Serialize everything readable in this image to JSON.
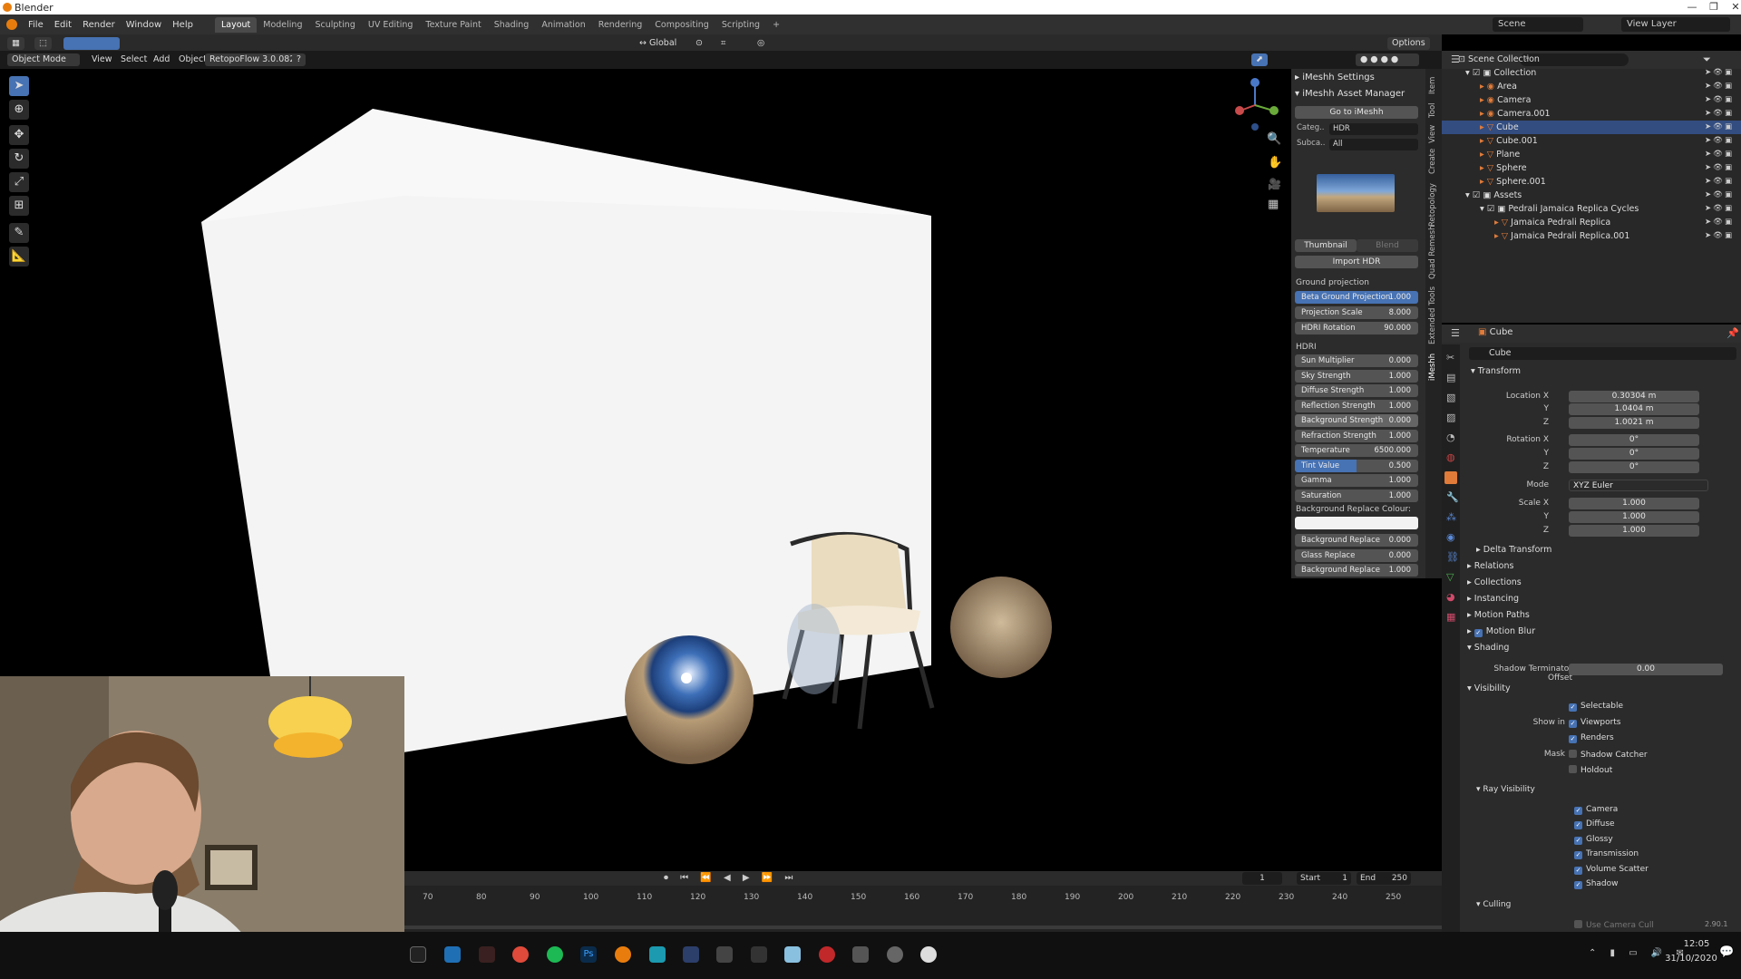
{
  "window": {
    "title": "Blender",
    "min": "—",
    "max": "❐",
    "close": "✕"
  },
  "menu": {
    "items": [
      "File",
      "Edit",
      "Render",
      "Window",
      "Help"
    ],
    "workspaces": [
      "Layout",
      "Modeling",
      "Sculpting",
      "UV Editing",
      "Texture Paint",
      "Shading",
      "Animation",
      "Rendering",
      "Compositing",
      "Scripting"
    ],
    "active_workspace": "Layout",
    "add_tab": "+",
    "scene": "Scene",
    "view_layer": "View Layer"
  },
  "viewport_header": {
    "orientation": "Global",
    "options": "Options"
  },
  "viewport_menu": {
    "mode": "Object Mode",
    "items": [
      "View",
      "Select",
      "Add",
      "Object"
    ],
    "addon": "RetopoFlow 3.0.082",
    "help": "?"
  },
  "npanel": {
    "imeshh_settings": "iMeshh Settings",
    "asset_manager": "iMeshh Asset Manager",
    "go_to": "Go to iMeshh",
    "category_label": "Categ..",
    "category_value": "HDR",
    "subcategory_label": "Subca..",
    "subcategory_value": "All",
    "thumbnail": "Thumbnail",
    "blend": "Blend",
    "import_hdr": "Import HDR",
    "ground_projection": "Ground projection",
    "ground_fields": [
      {
        "label": "Beta Ground Projection",
        "value": "1.000"
      },
      {
        "label": "Projection Scale",
        "value": "8.000"
      },
      {
        "label": "HDRI Rotation",
        "value": "90.000"
      }
    ],
    "hdri": "HDRI",
    "hdri_fields": [
      {
        "label": "Sun Multiplier",
        "value": "0.000"
      },
      {
        "label": "Sky Strength",
        "value": "1.000"
      },
      {
        "label": "Diffuse Strength",
        "value": "1.000"
      },
      {
        "label": "Reflection Strength",
        "value": "1.000"
      },
      {
        "label": "Background Strength",
        "value": "0.000"
      },
      {
        "label": "Refraction Strength",
        "value": "1.000"
      },
      {
        "label": "Temperature",
        "value": "6500.000"
      },
      {
        "label": "Tint Value",
        "value": "0.500"
      },
      {
        "label": "Gamma",
        "value": "1.000"
      },
      {
        "label": "Saturation",
        "value": "1.000"
      }
    ],
    "bg_replace_colour": "Background Replace Colour:",
    "bottom_fields": [
      {
        "label": "Background Replace",
        "value": "0.000"
      },
      {
        "label": "Glass Replace",
        "value": "0.000"
      },
      {
        "label": "Background Replace",
        "value": "1.000"
      }
    ],
    "vtabs": [
      "Item",
      "Tool",
      "View",
      "Create",
      "Retopology",
      "Quad Remesh",
      "Extended Tools",
      "iMeshh"
    ]
  },
  "outliner": {
    "rows": [
      {
        "name": "Scene Collection",
        "indent": 0
      },
      {
        "name": "Collection",
        "indent": 1
      },
      {
        "name": "Area",
        "indent": 2
      },
      {
        "name": "Camera",
        "indent": 2
      },
      {
        "name": "Camera.001",
        "indent": 2
      },
      {
        "name": "Cube",
        "indent": 2,
        "selected": true
      },
      {
        "name": "Cube.001",
        "indent": 2
      },
      {
        "name": "Plane",
        "indent": 2
      },
      {
        "name": "Sphere",
        "indent": 2
      },
      {
        "name": "Sphere.001",
        "indent": 2
      },
      {
        "name": "Assets",
        "indent": 1
      },
      {
        "name": "Pedrali Jamaica Replica Cycles",
        "indent": 2
      },
      {
        "name": "Jamaica Pedrali Replica",
        "indent": 3
      },
      {
        "name": "Jamaica Pedrali Replica.001",
        "indent": 3
      }
    ]
  },
  "properties": {
    "object": "Cube",
    "object_name": "Cube",
    "transform": "Transform",
    "location": {
      "label": "Location X",
      "x": "0.30304 m",
      "y": "1.0404 m",
      "z": "1.0021 m"
    },
    "rotation": {
      "label": "Rotation X",
      "x": "0°",
      "y": "0°",
      "z": "0°"
    },
    "mode_label": "Mode",
    "mode": "XYZ Euler",
    "scale": {
      "label": "Scale X",
      "x": "1.000",
      "y": "1.000",
      "z": "1.000"
    },
    "axis_y": "Y",
    "axis_z": "Z",
    "delta": "Delta Transform",
    "sections": [
      "Relations",
      "Collections",
      "Instancing",
      "Motion Paths",
      "Motion Blur"
    ],
    "shading": "Shading",
    "shadow_offset_label": "Shadow Terminator Offset",
    "shadow_offset": "0.00",
    "visibility": "Visibility",
    "selectable": "Selectable",
    "show_in": "Show in",
    "viewports": "Viewports",
    "renders": "Renders",
    "mask": "Mask",
    "shadow_catcher": "Shadow Catcher",
    "holdout": "Holdout",
    "ray_visibility": "Ray Visibility",
    "rays": [
      "Camera",
      "Diffuse",
      "Glossy",
      "Transmission",
      "Volume Scatter",
      "Shadow"
    ],
    "culling": "Culling",
    "use_camera_cull": "Use Camera Cull",
    "version": "2.90.1"
  },
  "timeline": {
    "frame": "1",
    "start_label": "Start",
    "start": "1",
    "end_label": "End",
    "end": "250",
    "ticks": [
      "70",
      "80",
      "90",
      "100",
      "110",
      "120",
      "130",
      "140",
      "150",
      "160",
      "170",
      "180",
      "190",
      "200",
      "210",
      "220",
      "230",
      "240",
      "250"
    ]
  },
  "taskbar": {
    "time": "12:05",
    "date": "31/10/2020"
  },
  "colors": {
    "accent": "#4772b3",
    "selection": "#334d80",
    "blender_orange": "#e87d0d"
  }
}
